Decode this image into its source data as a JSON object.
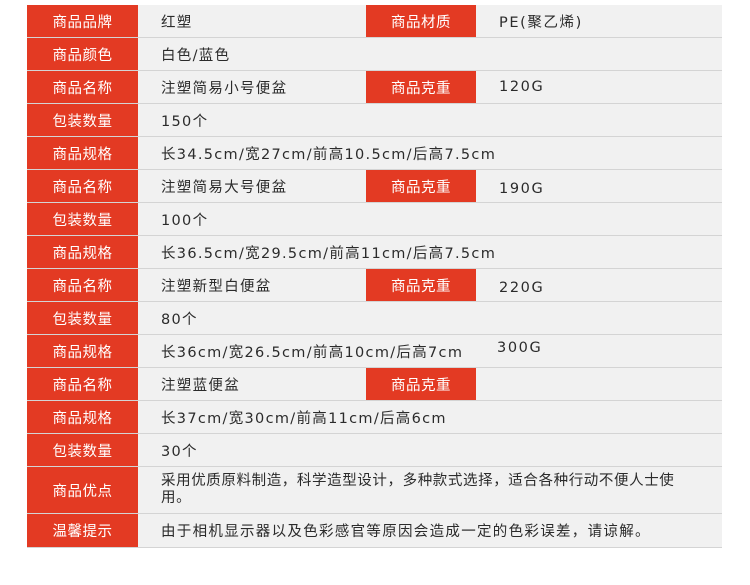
{
  "rows": [
    {
      "label": "商品品牌",
      "value": "红塑",
      "label2": "商品材质",
      "value2": "PE(聚乙烯)"
    },
    {
      "label": "商品颜色",
      "value": "白色/蓝色"
    },
    {
      "label": "商品名称",
      "value": "注塑简易小号便盆",
      "label2": "商品克重",
      "value2": "120G"
    },
    {
      "label": "包装数量",
      "value": "150个"
    },
    {
      "label": "商品规格",
      "value": "长34.5cm/宽27cm/前高10.5cm/后高7.5cm"
    },
    {
      "label": "商品名称",
      "value": "注塑简易大号便盆",
      "label2": "商品克重",
      "value2": "190G"
    },
    {
      "label": "包装数量",
      "value": "100个"
    },
    {
      "label": "商品规格",
      "value": "长36.5cm/宽29.5cm/前高11cm/后高7.5cm"
    },
    {
      "label": "商品名称",
      "value": "注塑新型白便盆",
      "label2": "商品克重",
      "value2": "220G"
    },
    {
      "label": "包装数量",
      "value": "80个"
    },
    {
      "label": "商品规格",
      "value": "长36cm/宽26.5cm/前高10cm/后高7cm",
      "value2": "300G"
    },
    {
      "label": "商品名称",
      "value": "注塑蓝便盆",
      "label2": "商品克重"
    },
    {
      "label": "商品规格",
      "value": "长37cm/宽30cm/前高11cm/后高6cm"
    },
    {
      "label": "包装数量",
      "value": "30个"
    },
    {
      "label": "商品优点",
      "value": "采用优质原料制造，科学造型设计，多种款式选择，适合各种行动不便人士使用。"
    },
    {
      "label": "温馨提示",
      "value": "由于相机显示器以及色彩感官等原因会造成一定的色彩误差，请谅解。"
    }
  ]
}
